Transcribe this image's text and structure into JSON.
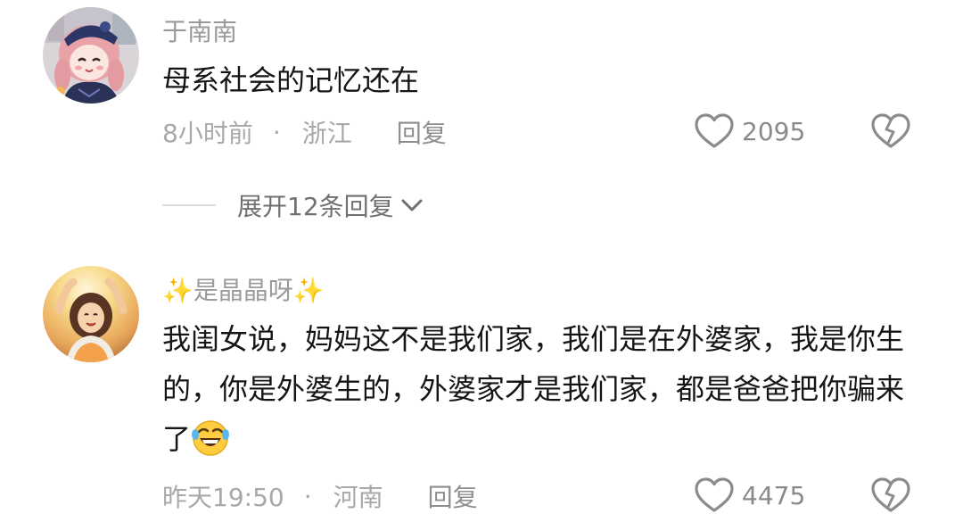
{
  "comments": [
    {
      "username": "于南南",
      "text": "母系社会的记忆还在",
      "time": "8小时前",
      "separator": "·",
      "location": "浙江",
      "reply_label": "回复",
      "likes": "2095",
      "avatar": "anime-girl-avatar"
    },
    {
      "username": "✨是晶晶呀✨",
      "text": "我闺女说，妈妈这不是我们家，我们是在外婆家，我是你生的，你是外婆生的，外婆家才是我们家，都是爸爸把你骗来了",
      "emoji": "rolling-laughing-emoji",
      "time": "昨天19:50",
      "separator": "·",
      "location": "河南",
      "reply_label": "回复",
      "likes": "4475",
      "avatar": "sunlit-woman-avatar"
    }
  ],
  "expand_replies": {
    "label": "展开12条回复",
    "icon": "chevron-down-icon"
  },
  "colors": {
    "meta": "#a8a8a8",
    "username": "#9a9a9a",
    "text": "#151515",
    "icon": "#8c8c8c"
  }
}
